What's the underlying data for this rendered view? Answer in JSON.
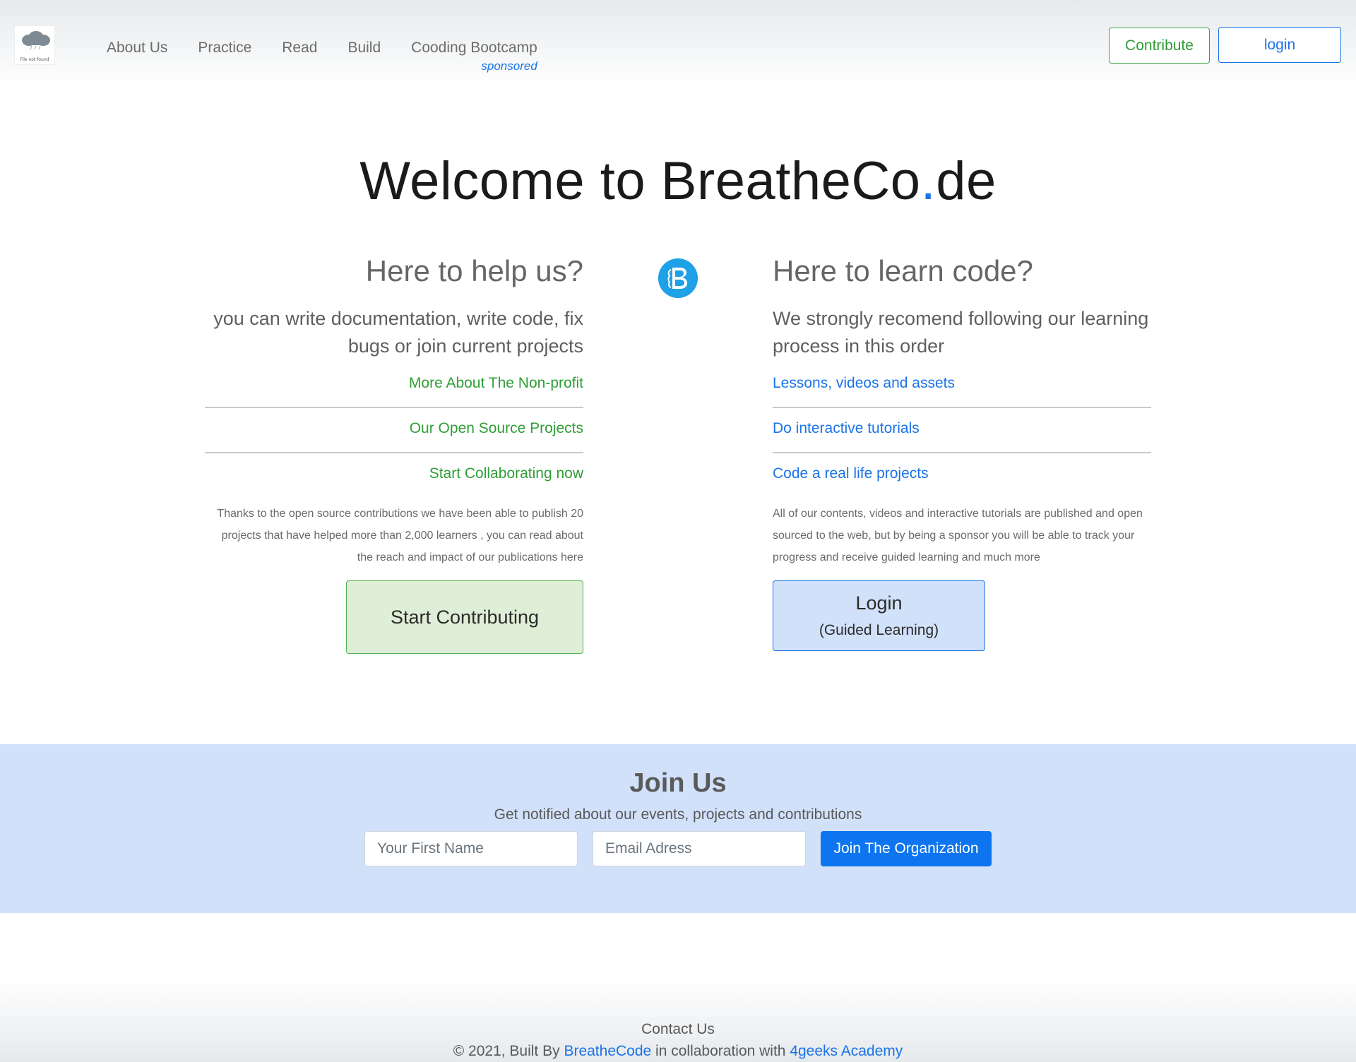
{
  "nav": {
    "logo_text": "File not found",
    "links": [
      "About Us",
      "Practice",
      "Read",
      "Build",
      "Cooding Bootcamp"
    ],
    "sponsored": "sponsored",
    "contribute": "Contribute",
    "login": "login"
  },
  "hero": {
    "title_part1": "Welcome to BreatheCo",
    "title_dot": ".",
    "title_part2": "de"
  },
  "help": {
    "title": "Here to help us?",
    "subtitle": "you can write documentation, write code, fix bugs or join current projects",
    "links": [
      "More About The Non-profit",
      "Our Open Source Projects",
      "Start Collaborating now"
    ],
    "note": "Thanks to the open source contributions we have been able to publish 20 projects that have helped more than 2,000 learners , you can read about the reach and impact of our publications here",
    "button": "Start Contributing"
  },
  "learn": {
    "title": "Here to learn code?",
    "subtitle": "We strongly recomend following our learning process in this order",
    "links": [
      "Lessons, videos and assets",
      "Do interactive tutorials",
      "Code a real life projects"
    ],
    "note": "All of our contents, videos and interactive tutorials are published and open sourced to the web, but by being a sponsor you will be able to track your progress and receive guided learning and much more",
    "button_line1": "Login",
    "button_line2": "(Guided Learning)"
  },
  "join": {
    "title": "Join Us",
    "subtitle": "Get notified about our events, projects and contributions",
    "name_placeholder": "Your First Name",
    "email_placeholder": "Email Adress",
    "button": "Join The Organization"
  },
  "footer": {
    "contact": "Contact Us",
    "copy_prefix": "© 2021, Built By ",
    "link1": "BreatheCode",
    "copy_mid": " in collaboration with ",
    "link2": "4geeks Academy"
  },
  "colors": {
    "accent_blue": "#1a73e8",
    "accent_green": "#2f9e36",
    "badge_blue": "#1ea1e6",
    "join_bg": "#d2e1fa"
  }
}
